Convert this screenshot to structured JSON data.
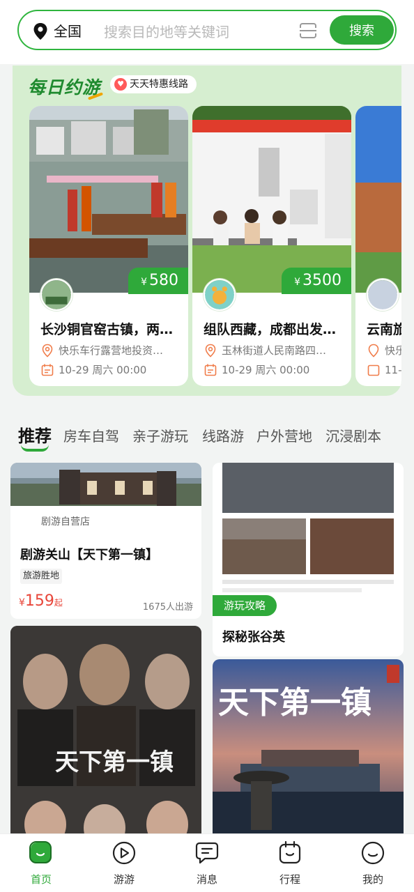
{
  "search": {
    "location": "全国",
    "placeholder": "搜索目的地等关键词",
    "button_label": "搜索"
  },
  "daily": {
    "title": "每日约游",
    "tag": "天天特惠线路",
    "cards": [
      {
        "title": "长沙铜官窑古镇，两…",
        "price": "580",
        "currency": "¥",
        "address": "快乐车行露营地投资…",
        "time": "10-29 周六 00:00"
      },
      {
        "title": "组队西藏，成都出发…",
        "price": "3500",
        "currency": "¥",
        "address": "玉林街道人民南路四…",
        "time": "10-29 周六 00:00"
      },
      {
        "title": "云南旅",
        "price": "",
        "currency": "¥",
        "address": "快乐",
        "time": "11-"
      }
    ]
  },
  "tabs": [
    "推荐",
    "房车自驾",
    "亲子游玩",
    "线路游",
    "户外营地",
    "沉浸剧本"
  ],
  "feed": {
    "card1": {
      "store": "剧游自营店",
      "title": "剧游关山【天下第一镇】",
      "tag": "旅游胜地",
      "currency": "¥",
      "price": "159",
      "price_suffix": "起",
      "count": "1675人出游"
    },
    "card2": {
      "tag": "游玩攻略",
      "title": "探秘张谷英"
    },
    "poster1_text": "天下第一镇",
    "poster2_text": "天下第一镇"
  },
  "nav": [
    {
      "label": "首页",
      "icon": "home-icon",
      "active": true
    },
    {
      "label": "游游",
      "icon": "play-icon",
      "active": false
    },
    {
      "label": "消息",
      "icon": "message-icon",
      "active": false
    },
    {
      "label": "行程",
      "icon": "itinerary-icon",
      "active": false
    },
    {
      "label": "我的",
      "icon": "profile-icon",
      "active": false
    }
  ],
  "colors": {
    "brand": "#2fa93a",
    "price_red": "#e8463a",
    "panel_bg": "#d6eed0"
  }
}
